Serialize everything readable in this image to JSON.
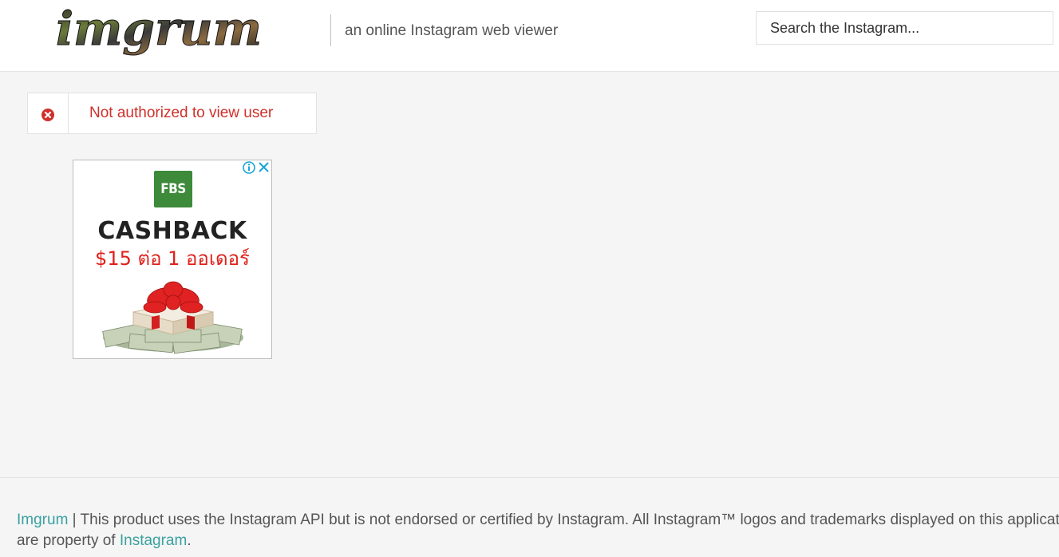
{
  "header": {
    "logo_text": "imgrum",
    "tagline": "an online Instagram web viewer",
    "search_placeholder": "Search the Instagram..."
  },
  "alert": {
    "message": "Not authorized to view user",
    "icon": "error-circle-icon",
    "color": "#d0302a"
  },
  "ad": {
    "logo_text": "FBS",
    "headline": "CASHBACK",
    "offer": "$15 ต่อ 1 ออเดอร์",
    "choices_icons": [
      "info-icon",
      "close-icon"
    ]
  },
  "footer": {
    "brand_link": "Imgrum",
    "line1_text": " | This product uses the Instagram API but is not endorsed or certified by Instagram. All Instagram™ logos and trademarks displayed on this application",
    "line2_prefix": "are property of ",
    "instagram_link": "Instagram",
    "line2_suffix": "."
  },
  "colors": {
    "link": "#3aa0a0",
    "error": "#d0302a",
    "background": "#f5f5f5"
  }
}
